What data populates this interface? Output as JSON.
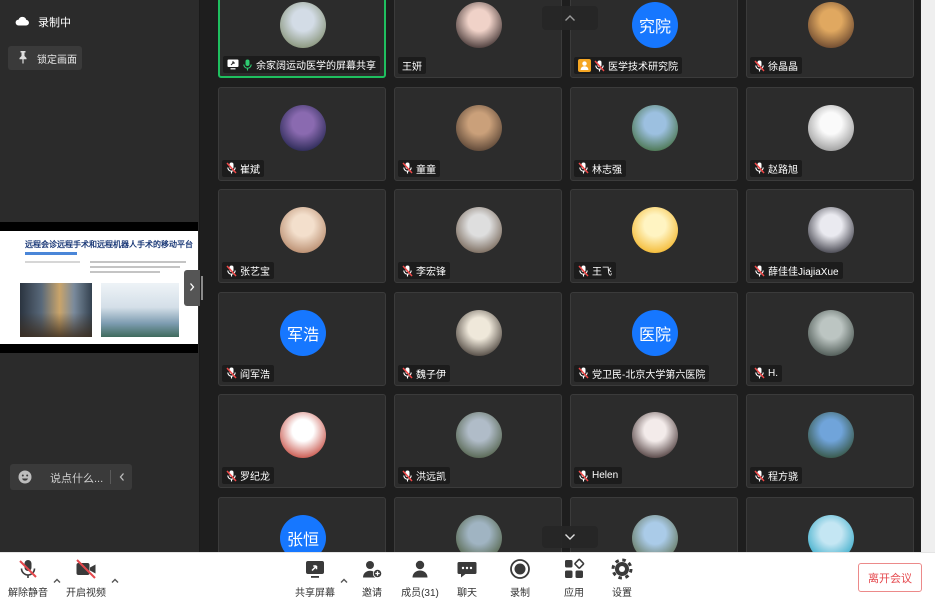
{
  "left_panel": {
    "recording": {
      "label": "录制中",
      "icon": "cloud-icon"
    },
    "lock_view": {
      "label": "锁定画面",
      "icon": "pin-icon"
    },
    "shared_screen": {
      "slide_title": "远程会诊远程手术和远程机器人手术的移动平台"
    },
    "chat_box": {
      "placeholder": "说点什么...",
      "icon": "emoji-icon",
      "fold_icon": "chevron-left-icon"
    },
    "collapse_icon": "chevron-right-icon"
  },
  "grid": {
    "scroll_up_icon": "chevron-up-icon",
    "scroll_down_icon": "chevron-down-icon",
    "participants": [
      {
        "name": "余家阔运动医学的屏幕共享",
        "mic_icon": "mic-on-icon",
        "badge_icon": "screen-share-icon",
        "active": true,
        "avatar_colors": [
          "#d3dce6",
          "#7d8a6a"
        ]
      },
      {
        "name": "王妍",
        "avatar_colors": [
          "#f0d2c8",
          "#2e2222"
        ]
      },
      {
        "name": "医学技术研究院",
        "mic_icon": "mic-muted-icon",
        "badge_icon": "host-icon",
        "avatar_text": "究院"
      },
      {
        "name": "徐晶晶",
        "mic_icon": "mic-muted-icon",
        "avatar_colors": [
          "#e0a860",
          "#5a3a28"
        ]
      },
      {
        "name": "崔斌",
        "mic_icon": "mic-muted-icon",
        "avatar_colors": [
          "#8a6ab0",
          "#1c2048"
        ]
      },
      {
        "name": "童童",
        "mic_icon": "mic-muted-icon",
        "avatar_colors": [
          "#caa07a",
          "#4a382c"
        ]
      },
      {
        "name": "林志强",
        "mic_icon": "mic-muted-icon",
        "avatar_colors": [
          "#9cc0e0",
          "#3e6a38"
        ]
      },
      {
        "name": "赵路旭",
        "mic_icon": "mic-muted-icon",
        "avatar_colors": [
          "#fafafa",
          "#8e8e8e"
        ]
      },
      {
        "name": "张艺宝",
        "mic_icon": "mic-muted-icon",
        "avatar_colors": [
          "#f3dfcc",
          "#b08060"
        ]
      },
      {
        "name": "李宏锋",
        "mic_icon": "mic-muted-icon",
        "avatar_colors": [
          "#dedede",
          "#6a5848"
        ]
      },
      {
        "name": "王飞",
        "mic_icon": "mic-muted-icon",
        "avatar_colors": [
          "#fff4c2",
          "#f2b01c"
        ]
      },
      {
        "name": "薛佳佳JiajiaXue",
        "mic_icon": "mic-muted-icon",
        "avatar_colors": [
          "#eaeaf0",
          "#2a2a34"
        ]
      },
      {
        "name": "阎军浩",
        "mic_icon": "mic-muted-icon",
        "avatar_text": "军浩"
      },
      {
        "name": "魏子伊",
        "mic_icon": "mic-muted-icon",
        "avatar_colors": [
          "#efe8da",
          "#38302a"
        ]
      },
      {
        "name": "党卫民-北京大学第六医院",
        "mic_icon": "mic-muted-icon",
        "avatar_text": "医院"
      },
      {
        "name": "H.",
        "mic_icon": "mic-muted-icon",
        "avatar_colors": [
          "#bcc5c2",
          "#3c4843"
        ]
      },
      {
        "name": "罗纪龙",
        "mic_icon": "mic-muted-icon",
        "avatar_colors": [
          "#ffffff",
          "#c03a2e"
        ]
      },
      {
        "name": "洪远凯",
        "mic_icon": "mic-muted-icon",
        "avatar_colors": [
          "#b0bcc8",
          "#48583e"
        ]
      },
      {
        "name": "Helen",
        "mic_icon": "mic-muted-icon",
        "avatar_colors": [
          "#f3ebea",
          "#3a2828"
        ]
      },
      {
        "name": "程方骁",
        "mic_icon": "mic-muted-icon",
        "avatar_colors": [
          "#70a4da",
          "#2e4a2e"
        ]
      },
      {
        "avatar_text": "张恒"
      },
      {
        "avatar_colors": [
          "#a0b4c2",
          "#4a5a3a"
        ]
      },
      {
        "avatar_colors": [
          "#aacbe8",
          "#5a6a48"
        ]
      },
      {
        "avatar_colors": [
          "#c4e6f3",
          "#26a4c4"
        ]
      }
    ]
  },
  "toolbar": {
    "unmute": {
      "label": "解除静音",
      "icon": "mic-off-icon"
    },
    "video": {
      "label": "开启视频",
      "icon": "video-off-icon"
    },
    "share": {
      "label": "共享屏幕",
      "icon": "share-screen-icon"
    },
    "invite": {
      "label": "邀请",
      "icon": "add-user-icon"
    },
    "members": {
      "label": "成员(31)",
      "icon": "members-icon"
    },
    "chat": {
      "label": "聊天",
      "icon": "chat-icon"
    },
    "record": {
      "label": "录制",
      "icon": "record-icon"
    },
    "apps": {
      "label": "应用",
      "icon": "apps-icon"
    },
    "settings": {
      "label": "设置",
      "icon": "gear-icon"
    },
    "leave": {
      "label": "离开会议"
    }
  },
  "colors": {
    "text_avatar": "#1677ff",
    "active_speaker": "#1fbf5f",
    "mic_on": "#2ecc71",
    "mic_muted_slash": "#f04848",
    "host_badge": "#f5a623",
    "leave": "#e5484d"
  }
}
